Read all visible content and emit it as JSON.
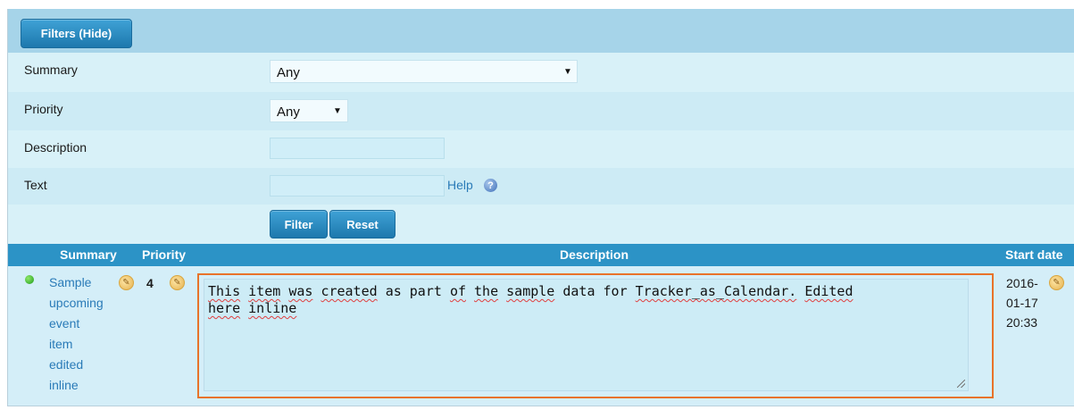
{
  "filters": {
    "toggle_label": "Filters (Hide)",
    "summary": {
      "label": "Summary",
      "selected": "Any"
    },
    "priority": {
      "label": "Priority",
      "selected": "Any"
    },
    "description": {
      "label": "Description",
      "value": ""
    },
    "text": {
      "label": "Text",
      "value": "",
      "help_label": "Help"
    },
    "filter_button": "Filter",
    "reset_button": "Reset"
  },
  "table": {
    "columns": [
      "Summary",
      "Priority",
      "Description",
      "Start date"
    ],
    "rows": [
      {
        "summary_lines": [
          "Sample",
          "upcoming",
          "event",
          "item",
          "edited",
          "inline"
        ],
        "priority": "4",
        "description_words": [
          "This",
          "item",
          "was",
          "created",
          "as",
          "part",
          "of",
          "the",
          "sample",
          "data",
          "for",
          "Tracker_as_Calendar.",
          "Edited",
          "here",
          "inline"
        ],
        "start_date_lines": [
          "2016-",
          "01-17",
          "20:33"
        ]
      }
    ]
  },
  "colors": {
    "accent_button": "#2a85bd",
    "header_bar": "#2c93c6",
    "link": "#2a7bb8",
    "highlight_outline": "#e8732a"
  },
  "icons": {
    "status": "green-status-dot-icon",
    "edit": "pencil-edit-icon",
    "help": "help-question-icon",
    "dropdown": "dropdown-arrow-icon",
    "resize": "resize-grip-icon"
  }
}
